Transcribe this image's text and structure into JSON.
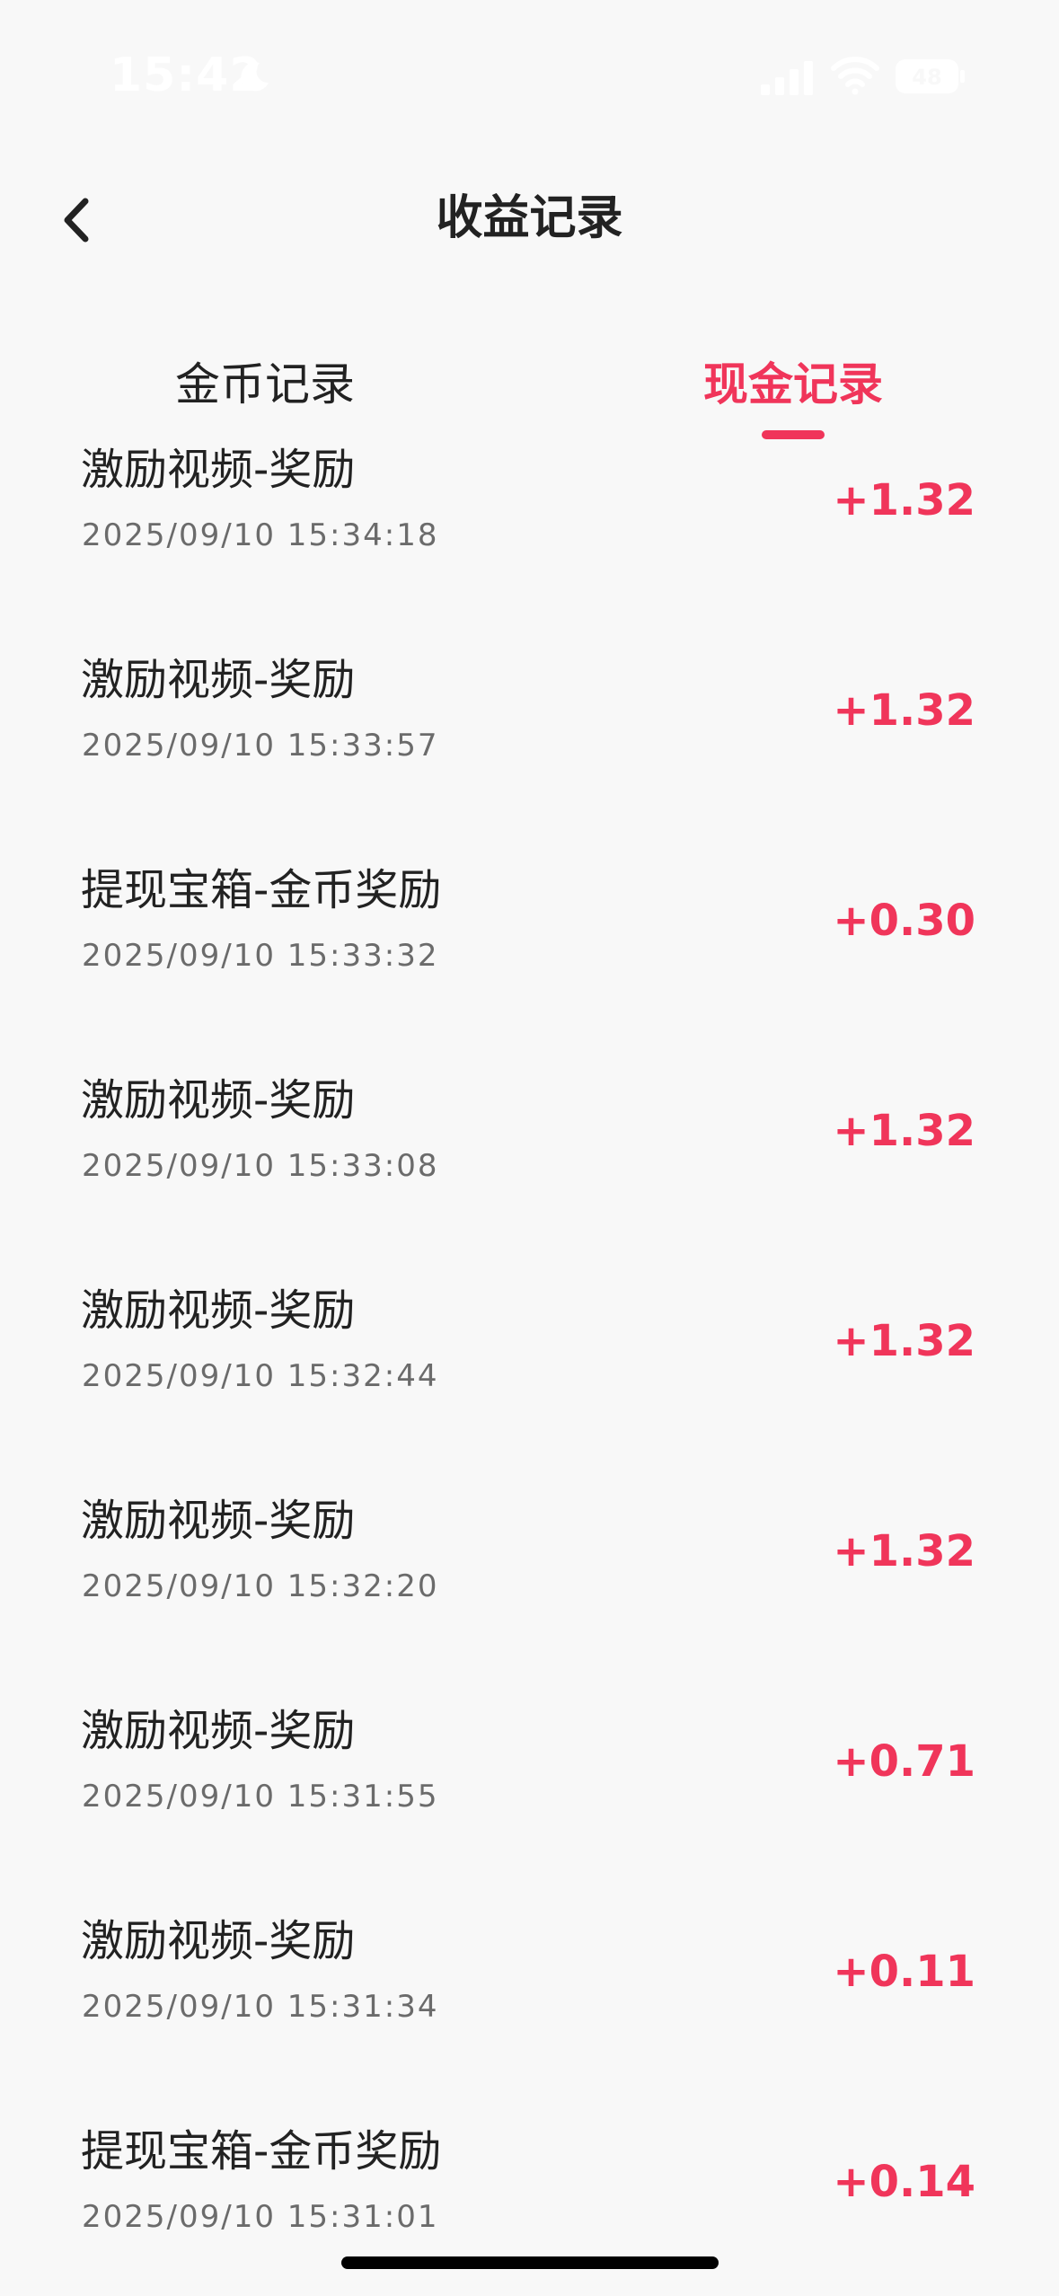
{
  "status_bar": {
    "time": "15:42",
    "battery": "48"
  },
  "header": {
    "back_icon": "chevron-left-icon",
    "title": "收益记录"
  },
  "tabs": [
    {
      "label": "金币记录",
      "active": false
    },
    {
      "label": "现金记录",
      "active": true
    }
  ],
  "records": [
    {
      "title": "激励视频-奖励",
      "time": "2025/09/10 15:34:18",
      "amount": "+1.32"
    },
    {
      "title": "激励视频-奖励",
      "time": "2025/09/10 15:33:57",
      "amount": "+1.32"
    },
    {
      "title": "提现宝箱-金币奖励",
      "time": "2025/09/10 15:33:32",
      "amount": "+0.30"
    },
    {
      "title": "激励视频-奖励",
      "time": "2025/09/10 15:33:08",
      "amount": "+1.32"
    },
    {
      "title": "激励视频-奖励",
      "time": "2025/09/10 15:32:44",
      "amount": "+1.32"
    },
    {
      "title": "激励视频-奖励",
      "time": "2025/09/10 15:32:20",
      "amount": "+1.32"
    },
    {
      "title": "激励视频-奖励",
      "time": "2025/09/10 15:31:55",
      "amount": "+0.71"
    },
    {
      "title": "激励视频-奖励",
      "time": "2025/09/10 15:31:34",
      "amount": "+0.11"
    },
    {
      "title": "提现宝箱-金币奖励",
      "time": "2025/09/10 15:31:01",
      "amount": "+0.14"
    }
  ],
  "colors": {
    "accent": "#f0355a",
    "background": "#f8f8f8",
    "text_primary": "#222222",
    "text_secondary": "#6b6b6b"
  }
}
